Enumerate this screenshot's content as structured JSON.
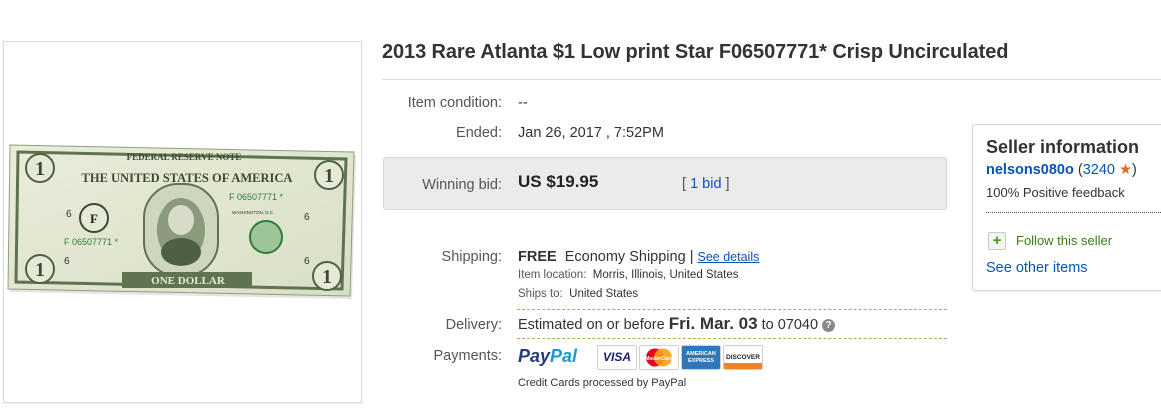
{
  "listing": {
    "title": "2013 Rare Atlanta $1 Low print Star F06507771* Crisp Uncirculated"
  },
  "image": {
    "alt_icon": "dollar-bill-image",
    "bill": {
      "header": "FEDERAL RESERVE NOTE",
      "country": "THE UNITED STATES OF AMERICA",
      "serial": "F 06507771 *",
      "serial_lower": "F 06507771 *",
      "denomination": "ONE DOLLAR",
      "corner": "1",
      "seal_letter": "F",
      "district_number": "6",
      "washington": "WASHINGTON, D.C."
    }
  },
  "details": {
    "condition_label": "Item condition:",
    "condition_value": "--",
    "ended_label": "Ended:",
    "ended_value": "Jan 26, 2017 , 7:52PM",
    "winning_bid_label": "Winning bid:",
    "winning_bid_value": "US $19.95",
    "bid_count_open": "[",
    "bid_count_link": "1 bid",
    "bid_count_close": "]",
    "shipping_label": "Shipping:",
    "shipping_free": "FREE",
    "shipping_method": "Economy Shipping",
    "shipping_sep": "|",
    "see_details": "See details",
    "item_location_label": "Item location:",
    "item_location_value": "Morris, Illinois, United States",
    "ships_to_label": "Ships to:",
    "ships_to_value": "United States",
    "delivery_label": "Delivery:",
    "delivery_prefix": "Estimated on or before",
    "delivery_date": "Fri. Mar. 03",
    "delivery_to": "to 07040",
    "delivery_help": "?",
    "payments_label": "Payments:",
    "paypal_part1": "Pay",
    "paypal_part2": "Pal",
    "cards": [
      "VISA",
      "MasterCard",
      "AMERICAN EXPRESS",
      "DISCOVER"
    ],
    "credit_note": "Credit Cards processed by PayPal"
  },
  "seller": {
    "title": "Seller information",
    "name": "nelsons080o",
    "score_open": "(",
    "score": "3240",
    "score_close": ")",
    "star": "★",
    "feedback": "100% Positive feedback",
    "follow_icon": "+",
    "follow_label": "Follow this seller",
    "see_other": "See other items"
  },
  "colors": {
    "link": "#0654ba",
    "bill_green": "#6a8a5a",
    "bid_box": "#ebebeb"
  }
}
